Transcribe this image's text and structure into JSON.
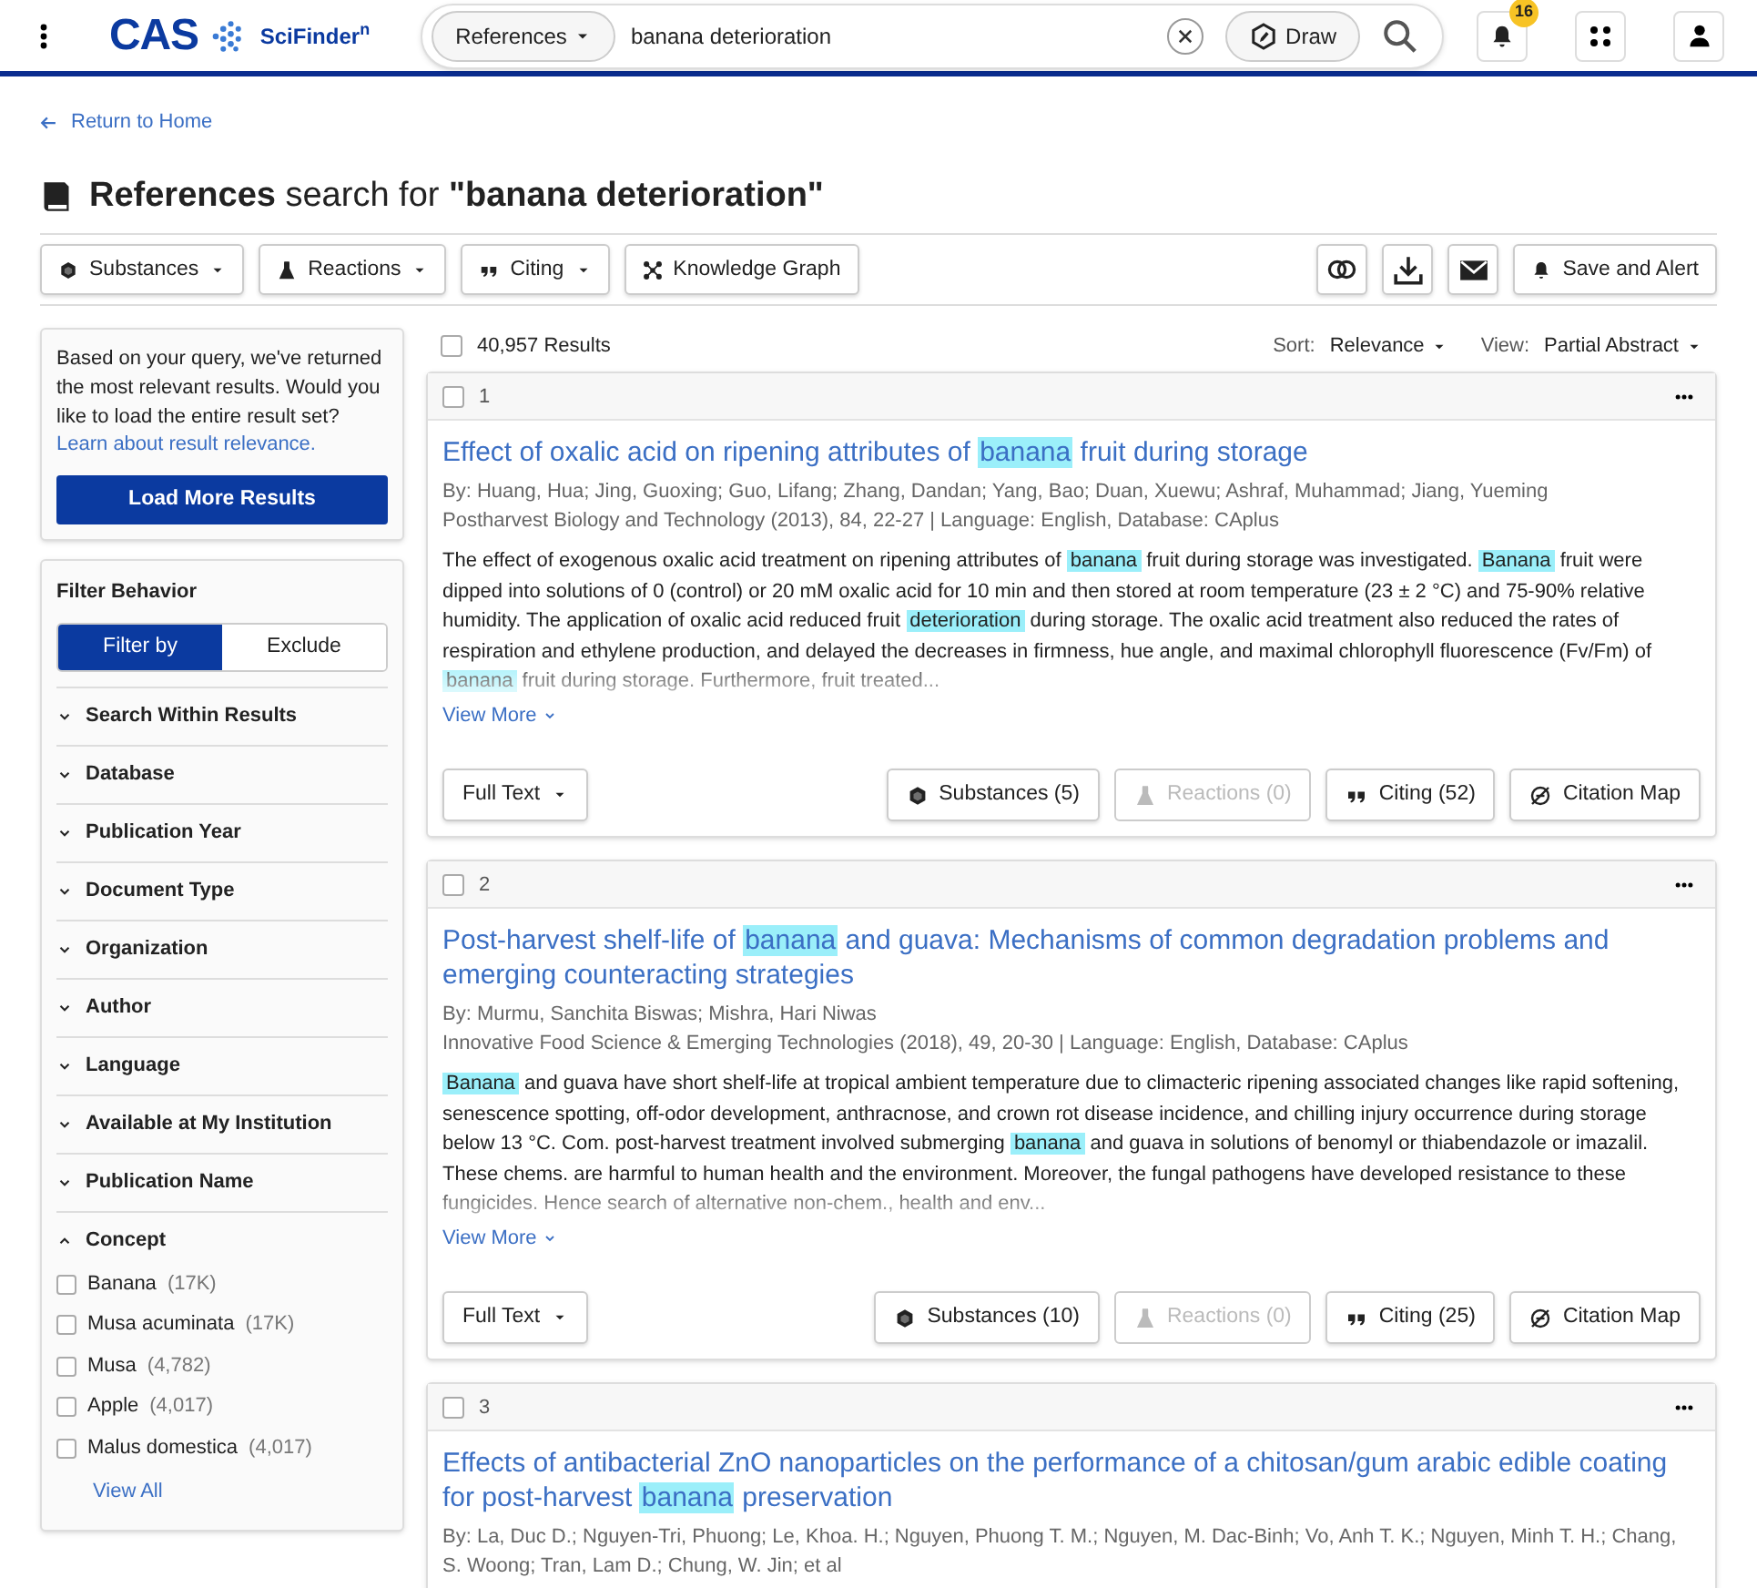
{
  "header": {
    "brand": "CAS",
    "product": "SciFinder$^{n}$",
    "search": {
      "scope": "References",
      "value": "banana deterioration",
      "draw": "Draw"
    },
    "notification_count": "16"
  },
  "back_link": "Return to Home",
  "heading": "**References** search for **\"banana deterioration\"**",
  "toolbar": {
    "left": [
      {
        "label": "Substances",
        "kind": "dropdown"
      },
      {
        "label": "Reactions",
        "kind": "dropdown"
      },
      {
        "label": "Citing",
        "kind": "dropdown"
      },
      {
        "label": "Knowledge Graph",
        "kind": "button"
      }
    ],
    "right_label": "Save and Alert"
  },
  "sidebar": {
    "notice": {
      "text": "Based on your query, we've returned the most relevant results. Would you like to load the entire result set?",
      "link": "Learn about result relevance.",
      "button": "Load More Results"
    },
    "filter": {
      "title": "Filter Behavior",
      "options": [
        {
          "label": "Filter by",
          "selected": true
        },
        {
          "label": "Exclude",
          "selected": false
        }
      ],
      "sections": [
        {
          "label": "Search Within Results",
          "expanded": false
        },
        {
          "label": "Database",
          "expanded": false
        },
        {
          "label": "Publication Year",
          "expanded": false
        },
        {
          "label": "Document Type",
          "expanded": false
        },
        {
          "label": "Organization",
          "expanded": false
        },
        {
          "label": "Author",
          "expanded": false
        },
        {
          "label": "Language",
          "expanded": false
        },
        {
          "label": "Available at My Institution",
          "expanded": false
        },
        {
          "label": "Publication Name",
          "expanded": false
        },
        {
          "label": "Concept",
          "expanded": true,
          "items": [
            {
              "label": "Banana",
              "count": "(17K)",
              "checked": false
            },
            {
              "label": "Musa acuminata",
              "count": "(17K)",
              "checked": false
            },
            {
              "label": "Musa",
              "count": "(4,782)",
              "checked": false
            },
            {
              "label": "Apple",
              "count": "(4,017)",
              "checked": false
            },
            {
              "label": "Malus domestica",
              "count": "(4,017)",
              "checked": false
            }
          ],
          "view_all": "View All"
        }
      ]
    }
  },
  "results_bar": {
    "select_all_checked": false,
    "count": "40,957 Results",
    "sort_label": "Sort:",
    "sort_value": "Relevance",
    "view_label": "View:",
    "view_value": "Partial Abstract"
  },
  "results": [
    {
      "number": "1",
      "checked": false,
      "title": [
        {
          "text": "Effect of oxalic acid on ripening attributes of ",
          "highlight": false
        },
        {
          "text": "banana",
          "highlight": true
        },
        {
          "text": " fruit during storage",
          "highlight": false
        }
      ],
      "authors": "By: Huang, Hua; Jing, Guoxing; Guo, Lifang; Zhang, Dandan; Yang, Bao; Duan, Xuewu; Ashraf, Muhammad; Jiang, Yueming",
      "source": "Postharvest Biology and Technology (2013), 84, 22-27 | Language: English, Database: CAplus",
      "abstract": [
        {
          "text": "The effect of exogenous oxalic acid treatment on ripening attributes of ",
          "highlight": false
        },
        {
          "text": "banana",
          "highlight": true
        },
        {
          "text": " fruit during storage was investigated. ",
          "highlight": false
        },
        {
          "text": "Banana",
          "highlight": true
        },
        {
          "text": " fruit were dipped into solutions of 0 (control) or 20 mM oxalic acid for 10 min and then stored at room temperature (23 ± 2 °C) and 75-90% relative humidity. The application of oxalic acid reduced fruit ",
          "highlight": false
        },
        {
          "text": "deterioration",
          "highlight": true
        },
        {
          "text": " during storage. The oxalic acid treatment also reduced the rates of respiration and ethylene production, and delayed the decreases in firmness, hue angle, and maximal chlorophyll fluorescence (Fv/Fm) of ",
          "highlight": false
        },
        {
          "text": "banana",
          "highlight": true
        },
        {
          "text": " fruit during storage. Furthermore, fruit treated...",
          "highlight": false
        }
      ],
      "view_more": "View More",
      "actions": [
        {
          "label": "Full Text",
          "kind": "dropdown",
          "disabled": false
        },
        {
          "label": "Substances (5)",
          "kind": "button",
          "disabled": false
        },
        {
          "label": "Reactions (0)",
          "kind": "button",
          "disabled": true
        },
        {
          "label": "Citing (52)",
          "kind": "button",
          "disabled": false
        },
        {
          "label": "Citation Map",
          "kind": "button",
          "disabled": false
        }
      ]
    },
    {
      "number": "2",
      "checked": false,
      "title": [
        {
          "text": "Post-harvest shelf-life of ",
          "highlight": false
        },
        {
          "text": "banana",
          "highlight": true
        },
        {
          "text": " and guava: Mechanisms of common degradation problems and emerging counteracting strategies",
          "highlight": false
        }
      ],
      "authors": "By: Murmu, Sanchita Biswas; Mishra, Hari Niwas",
      "source": "Innovative Food Science & Emerging Technologies (2018), 49, 20-30 | Language: English, Database: CAplus",
      "abstract": [
        {
          "text": "Banana",
          "highlight": true
        },
        {
          "text": " and guava have short shelf-life at tropical ambient temperature due to climacteric ripening associated changes like rapid softening, senescence spotting, off-odor development, anthracnose, and crown rot disease incidence, and chilling injury occurrence during storage below 13 °C. Com. post-harvest treatment involved submerging ",
          "highlight": false
        },
        {
          "text": "banana",
          "highlight": true
        },
        {
          "text": " and guava in solutions of benomyl or thiabendazole or imazalil. These chems. are harmful to human health and the environment. Moreover, the fungal pathogens have developed resistance to these fungicides. Hence search of alternative non-chem., health and env...",
          "highlight": false
        }
      ],
      "view_more": "View More",
      "actions": [
        {
          "label": "Full Text",
          "kind": "dropdown",
          "disabled": false
        },
        {
          "label": "Substances (10)",
          "kind": "button",
          "disabled": false
        },
        {
          "label": "Reactions (0)",
          "kind": "button",
          "disabled": true
        },
        {
          "label": "Citing (25)",
          "kind": "button",
          "disabled": false
        },
        {
          "label": "Citation Map",
          "kind": "button",
          "disabled": false
        }
      ]
    },
    {
      "number": "3",
      "checked": false,
      "title": [
        {
          "text": "Effects of antibacterial ZnO nanoparticles on the performance of a chitosan/gum arabic edible coating for post-harvest ",
          "highlight": false
        },
        {
          "text": "banana",
          "highlight": true
        },
        {
          "text": " preservation",
          "highlight": false
        }
      ],
      "authors": "By: La, Duc D.; Nguyen-Tri, Phuong; Le, Khoa. H.; Nguyen, Phuong T. M.; Nguyen, M. Dac-Binh; Vo, Anh T. K.; Nguyen, Minh T. H.; Chang, S. Woong; Tran, Lam D.; Chung, W. Jin; et al"
    }
  ]
}
